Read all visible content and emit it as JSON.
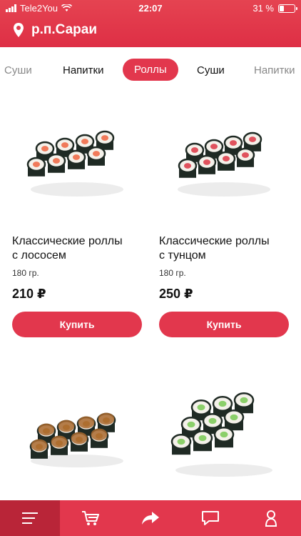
{
  "status_bar": {
    "carrier": "Tele2You",
    "time": "22:07",
    "battery": "31 %",
    "battery_level": 0.31
  },
  "header": {
    "location": "р.п.Сараи",
    "location_icon": "map-pin-icon"
  },
  "tabs": [
    {
      "label": "Суши"
    },
    {
      "label": "Напитки"
    },
    {
      "label": "Роллы",
      "active": true
    },
    {
      "label": "Суши"
    },
    {
      "label": "Напитки"
    }
  ],
  "products": [
    {
      "title_line1": "Классические роллы",
      "title_line2": "с лососем",
      "weight": "180 гр.",
      "price": "210 ₽",
      "buy_label": "Купить"
    },
    {
      "title_line1": "Классические роллы",
      "title_line2": "с тунцом",
      "weight": "180 гр.",
      "price": "250 ₽",
      "buy_label": "Купить"
    },
    {
      "image": "unagi-roll"
    },
    {
      "image": "cucumber-roll"
    }
  ],
  "bottom_nav": {
    "items": [
      {
        "icon": "menu-icon",
        "active": true
      },
      {
        "icon": "cart-icon"
      },
      {
        "icon": "share-icon"
      },
      {
        "icon": "chat-icon"
      },
      {
        "icon": "profile-icon"
      }
    ]
  },
  "colors": {
    "accent": "#e2374d",
    "accent_dark": "#b92538"
  }
}
